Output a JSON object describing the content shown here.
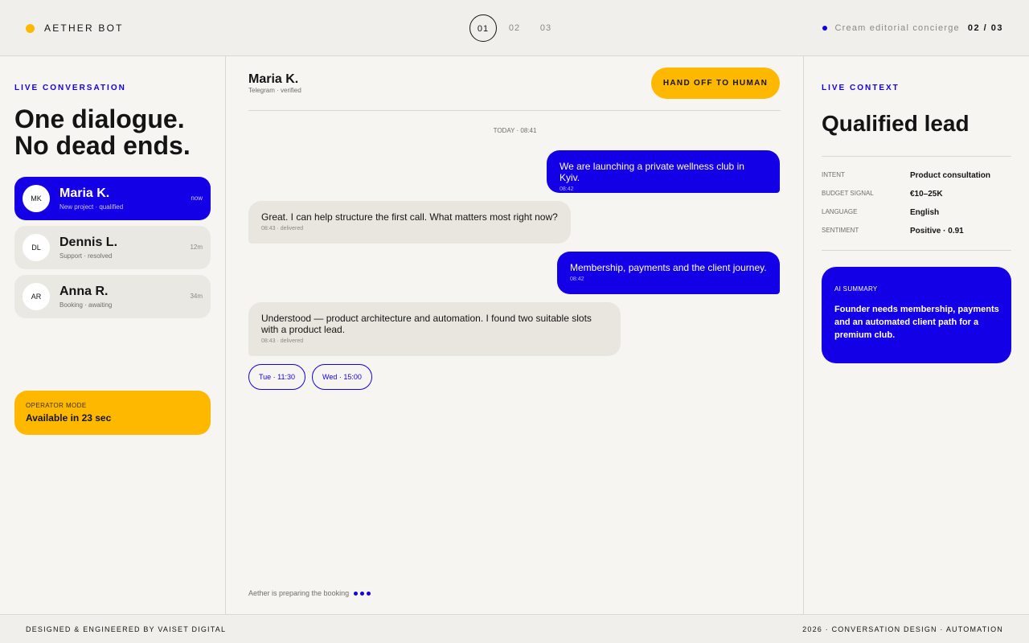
{
  "header": {
    "brand": "AETHER BOT",
    "steps": [
      "01",
      "02",
      "03"
    ],
    "active_step": "01",
    "tagline": "Cream editorial concierge",
    "counter": "02 / 03"
  },
  "sidebar": {
    "eyebrow": "LIVE CONVERSATION",
    "headline_line1": "One dialogue.",
    "headline_line2": "No dead ends.",
    "conversations": [
      {
        "initials": "MK",
        "name": "Maria K.",
        "sub": "New project · qualified",
        "time": "now",
        "active": true
      },
      {
        "initials": "DL",
        "name": "Dennis L.",
        "sub": "Support · resolved",
        "time": "12m",
        "active": false
      },
      {
        "initials": "AR",
        "name": "Anna R.",
        "sub": "Booking · awaiting",
        "time": "34m",
        "active": false
      }
    ],
    "operator": {
      "label": "OPERATOR MODE",
      "value": "Available in 23 sec"
    }
  },
  "chat": {
    "contact_name": "Maria K.",
    "contact_sub": "Telegram · verified",
    "handoff_label": "HAND OFF TO HUMAN",
    "timestamp": "TODAY · 08:41",
    "messages": [
      {
        "dir": "out",
        "text": "We are launching a private wellness club in Kyiv.",
        "meta": "08:42"
      },
      {
        "dir": "in",
        "text": "Great. I can help structure the first call. What matters most right now?",
        "meta": "08:43 · delivered"
      },
      {
        "dir": "out",
        "text": "Membership, payments and the client journey.",
        "meta": "08:42"
      },
      {
        "dir": "in",
        "text_line1": "Understood — product architecture and automation. I found two suitable slots",
        "text_line2": "with a product lead.",
        "meta": "08:43 · delivered"
      }
    ],
    "slots": [
      "Tue · 11:30",
      "Wed · 15:00"
    ],
    "typing": "Aether is preparing the booking"
  },
  "context": {
    "eyebrow": "LIVE CONTEXT",
    "title": "Qualified lead",
    "fields": [
      {
        "key": "INTENT",
        "value": "Product consultation"
      },
      {
        "key": "BUDGET SIGNAL",
        "value": "€10–25K"
      },
      {
        "key": "LANGUAGE",
        "value": "English"
      },
      {
        "key": "SENTIMENT",
        "value": "Positive · 0.91"
      }
    ],
    "summary_label": "AI SUMMARY",
    "summary_text": "Founder needs membership, payments and an automated client path for a premium club."
  },
  "footer": {
    "left": "DESIGNED & ENGINEERED BY VAISET DIGITAL",
    "right": "2026 · CONVERSATION DESIGN · AUTOMATION"
  },
  "colors": {
    "accent_blue": "#1400e6",
    "accent_yellow": "#ffb800",
    "background": "#f6f5f1"
  }
}
